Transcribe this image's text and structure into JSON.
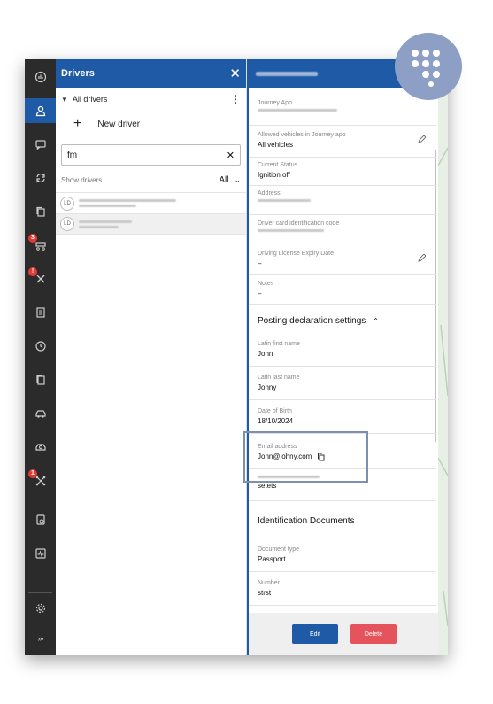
{
  "rail": {
    "items": [
      {
        "icon": "dashboard-icon",
        "active": false,
        "badge": ""
      },
      {
        "icon": "driver-icon",
        "active": true,
        "badge": ""
      },
      {
        "icon": "chat-icon",
        "active": false,
        "badge": ""
      },
      {
        "icon": "sync-icon",
        "active": false,
        "badge": ""
      },
      {
        "icon": "copy-icon",
        "active": false,
        "badge": ""
      },
      {
        "icon": "route-icon",
        "active": false,
        "badge": "3"
      },
      {
        "icon": "tools-icon",
        "active": false,
        "badge": "!"
      },
      {
        "icon": "document-icon",
        "active": false,
        "badge": ""
      },
      {
        "icon": "history-icon",
        "active": false,
        "badge": ""
      },
      {
        "icon": "files-icon",
        "active": false,
        "badge": ""
      },
      {
        "icon": "vehicle-icon",
        "active": false,
        "badge": ""
      },
      {
        "icon": "vehicle-settings-icon",
        "active": false,
        "badge": ""
      },
      {
        "icon": "network-icon",
        "active": false,
        "badge": "1"
      },
      {
        "icon": "report-icon",
        "active": false,
        "badge": ""
      },
      {
        "icon": "monitor-icon",
        "active": false,
        "badge": ""
      },
      {
        "icon": "gear-icon",
        "active": false,
        "badge": ""
      },
      {
        "icon": "expand-icon",
        "active": false,
        "badge": ""
      }
    ],
    "expand_label": "›››"
  },
  "drivers_panel": {
    "title": "Drivers",
    "close": "✕",
    "filter_label": "All drivers",
    "new_driver_label": "New driver",
    "search_value": "fm",
    "search_clear": "✕",
    "show_label": "Show drivers",
    "show_value": "All",
    "list": [
      {
        "initials": "LD",
        "selected": false
      },
      {
        "initials": "LD",
        "selected": true
      }
    ]
  },
  "details": {
    "fields": {
      "journey_app_label": "Journey App",
      "allowed_label": "Allowed vehicles in Journey app",
      "allowed_value": "All vehicles",
      "status_label": "Current Status",
      "status_value": "Ignition off",
      "address_label": "Address",
      "card_label": "Driver card identification code",
      "license_label": "Driving License Expiry Date",
      "license_value": "–",
      "notes_label": "Notes",
      "notes_value": "–",
      "posting_title": "Posting declaration settings",
      "first_name_label": "Latin first name",
      "first_name_value": "John",
      "last_name_label": "Latin last name",
      "last_name_value": "Johny",
      "dob_label": "Date of Birth",
      "dob_value": "18/10/2024",
      "email_label": "Email address",
      "email_value": "John@johny.com",
      "street_value": "setets",
      "id_docs_title": "Identification Documents",
      "doc_type_label": "Document type",
      "doc_type_value": "Passport",
      "number_label": "Number",
      "number_value": "strst"
    },
    "edit_label": "Edit",
    "delete_label": "Delete"
  },
  "colors": {
    "brand_blue": "#1f5aa6",
    "delete_red": "#e5545c",
    "rail_bg": "#2b2b2b",
    "highlight_border": "#7b8fb0"
  }
}
